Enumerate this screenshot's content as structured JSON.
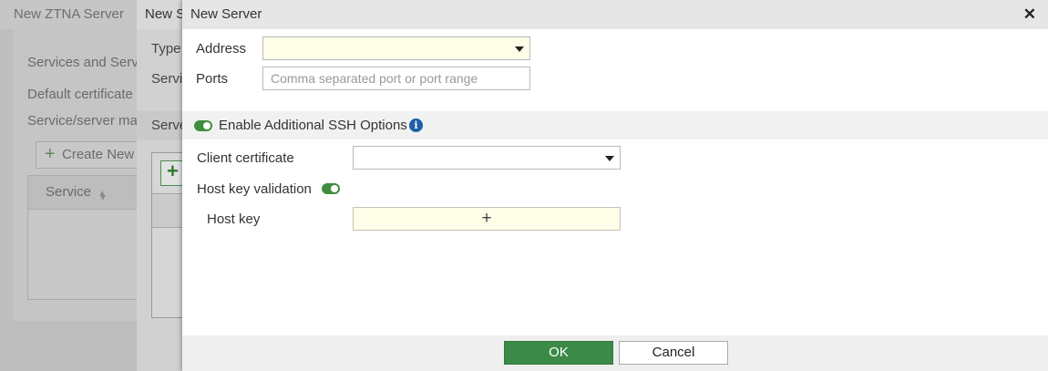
{
  "background_dialog_1": {
    "title": "New ZTNA Server",
    "section_heading": "Services and Serve",
    "default_certificate_label": "Default certificate",
    "service_mapping_label": "Service/server map",
    "create_new_label": "Create New",
    "table_header_service": "Service"
  },
  "background_dialog_2": {
    "title": "New S",
    "type_label": "Type",
    "service_label": "Servi",
    "servers_section": "Serve"
  },
  "dialog": {
    "title": "New Server",
    "address_label": "Address",
    "address_value": "",
    "ports_label": "Ports",
    "ports_placeholder": "Comma separated port or port range",
    "ssh_section_label": "Enable Additional SSH Options",
    "ssh_enabled": true,
    "client_cert_label": "Client certificate",
    "client_cert_value": "",
    "host_key_validation_label": "Host key validation",
    "host_key_validation_enabled": true,
    "host_key_label": "Host key",
    "add_symbol": "+",
    "info_symbol": "i",
    "close_symbol": "✕",
    "ok_label": "OK",
    "cancel_label": "Cancel"
  },
  "colors": {
    "accent_green": "#3b8a48",
    "info_blue": "#1f5fa8",
    "field_highlight": "#fefde8"
  }
}
